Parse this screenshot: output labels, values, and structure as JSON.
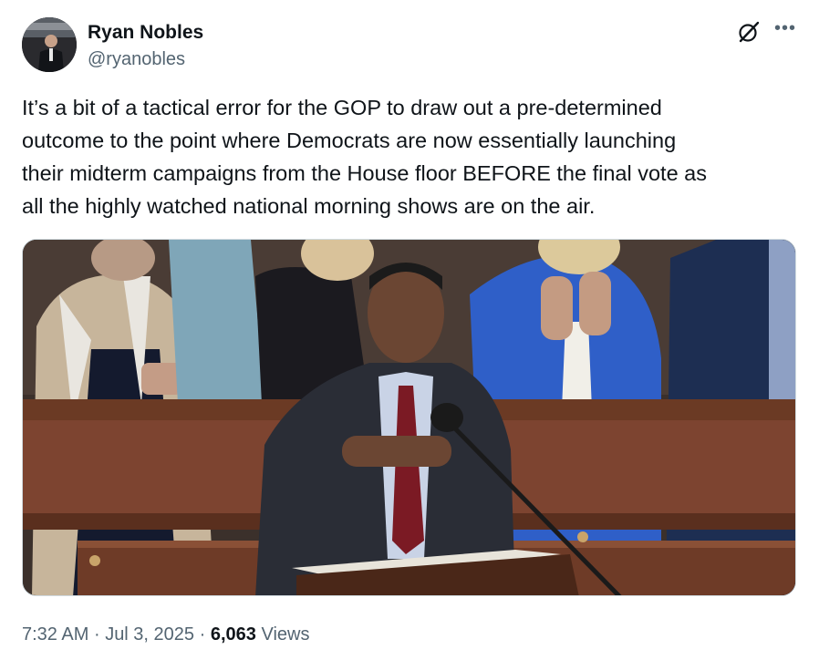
{
  "author": {
    "name": "Ryan Nobles",
    "handle": "@ryanobles",
    "avatar_icon": "profile-photo"
  },
  "icons": {
    "grok": "grok-icon",
    "more": "more-options-icon"
  },
  "tweet": {
    "text": "It’s a bit of a tactical error for the GOP to draw out a pre-determined\noutcome to the point where Democrats are now essentially launching\ntheir midterm campaigns from the House floor BEFORE the final vote as\nall the highly watched national morning shows are on the air."
  },
  "media": {
    "type": "photo"
  },
  "meta": {
    "time": "7:32 AM",
    "separator": "·",
    "date": "Jul 3, 2025",
    "views_count": "6,063",
    "views_label": "Views"
  },
  "colors": {
    "text_primary": "#0f1419",
    "text_secondary": "#536471",
    "border": "#cfd9de"
  }
}
